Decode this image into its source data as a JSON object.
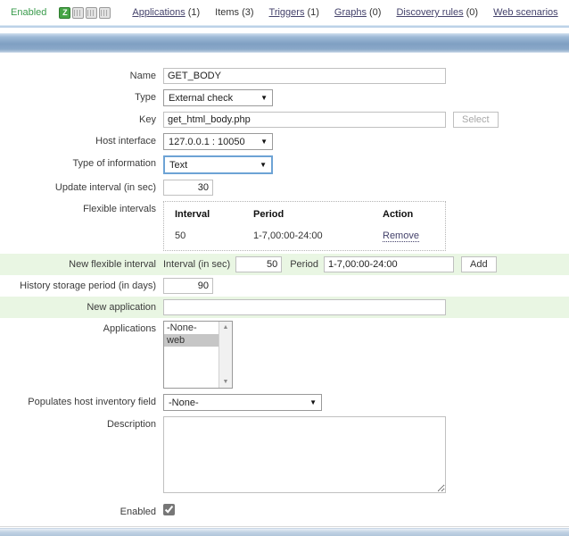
{
  "topbar": {
    "status_label": "Enabled",
    "zbx_icon_letter": "Z",
    "nav": [
      {
        "label": "Applications",
        "count": "(1)",
        "is_link": true
      },
      {
        "label": "Items",
        "count": "(3)",
        "is_link": false
      },
      {
        "label": "Triggers",
        "count": "(1)",
        "is_link": true
      },
      {
        "label": "Graphs",
        "count": "(0)",
        "is_link": true
      },
      {
        "label": "Discovery rules",
        "count": "(0)",
        "is_link": true
      },
      {
        "label": "Web scenarios",
        "count": "",
        "is_link": true
      }
    ]
  },
  "form": {
    "name_label": "Name",
    "name_value": "GET_BODY",
    "type_label": "Type",
    "type_value": "External check",
    "key_label": "Key",
    "key_value": "get_html_body.php",
    "select_button": "Select",
    "host_interface_label": "Host interface",
    "host_interface_value": "127.0.0.1 : 10050",
    "type_info_label": "Type of information",
    "type_info_value": "Text",
    "update_interval_label": "Update interval (in sec)",
    "update_interval_value": "30",
    "flex_label": "Flexible intervals",
    "flex_headers": {
      "interval": "Interval",
      "period": "Period",
      "action": "Action"
    },
    "flex_row": {
      "interval": "50",
      "period": "1-7,00:00-24:00",
      "action": "Remove"
    },
    "new_flex_label": "New flexible interval",
    "new_flex_interval_label": "Interval (in sec)",
    "new_flex_interval_value": "50",
    "new_flex_period_label": "Period",
    "new_flex_period_value": "1-7,00:00-24:00",
    "add_button": "Add",
    "history_label": "History storage period (in days)",
    "history_value": "90",
    "new_app_label": "New application",
    "new_app_value": "",
    "applications_label": "Applications",
    "applications_options": {
      "none": "-None-",
      "web": "web"
    },
    "applications_selected": "web",
    "inventory_label": "Populates host inventory field",
    "inventory_value": "-None-",
    "description_label": "Description",
    "description_value": "",
    "enabled_label": "Enabled",
    "enabled_checked": "checked"
  },
  "colors": {
    "status_green": "#3a9b4c",
    "link": "#44426b",
    "row_green": "#e9f6e3",
    "focus_blue": "#6da3d5",
    "zbx_icon_green": "#46a546"
  }
}
